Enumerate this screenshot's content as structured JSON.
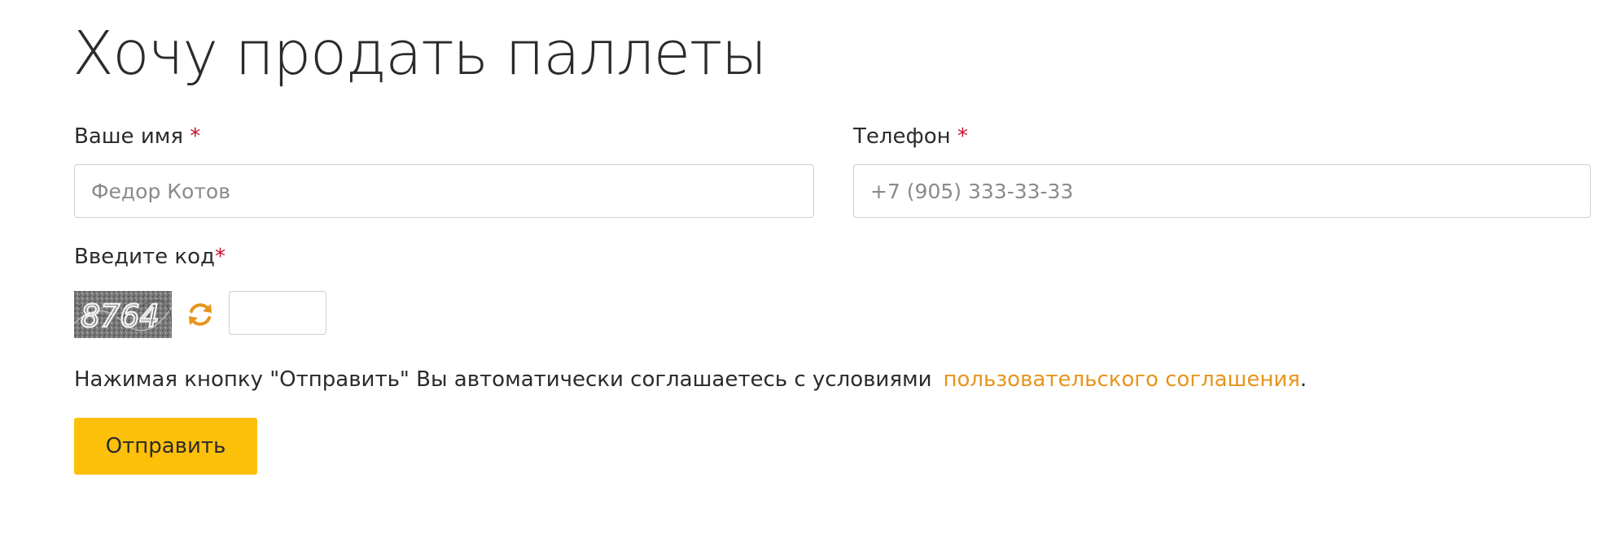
{
  "page": {
    "title": "Хочу продать паллеты"
  },
  "form": {
    "name": {
      "label": "Ваше имя",
      "required_mark": "*",
      "placeholder": "Федор Котов",
      "value": ""
    },
    "phone": {
      "label": "Телефон",
      "required_mark": "*",
      "placeholder": "+7 (905) 333-33-33",
      "value": ""
    },
    "captcha": {
      "label": "Введите код",
      "required_mark": "*",
      "image_text": "8764",
      "refresh_icon": "refresh-icon",
      "value": ""
    },
    "agreement": {
      "text": "Нажимая кнопку \"Отправить\" Вы автоматически соглашаетесь с условиями",
      "link_text": "пользовательского соглашения",
      "suffix": "."
    },
    "submit_label": "Отправить"
  },
  "colors": {
    "accent_button": "#fdc009",
    "link": "#e6951b",
    "required": "#c8102e",
    "text": "#2b2b2b",
    "input_border": "#cfcfcf"
  }
}
